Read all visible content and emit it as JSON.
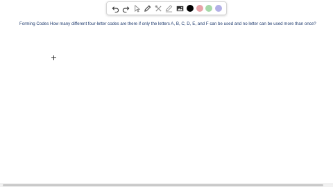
{
  "question": {
    "text": "Forming Codes How many different four-letter codes are there if only the letters A, B, C, D, E, and F can be used and no letter can be used more than once?"
  },
  "toolbar": {
    "tools": [
      "undo-icon",
      "redo-icon",
      "pointer-icon",
      "pencil-icon",
      "tools-icon",
      "highlighter-icon",
      "image-icon"
    ],
    "colors": [
      "#000000",
      "#e8a3a8",
      "#a6d8a8",
      "#b2b0e6"
    ]
  }
}
